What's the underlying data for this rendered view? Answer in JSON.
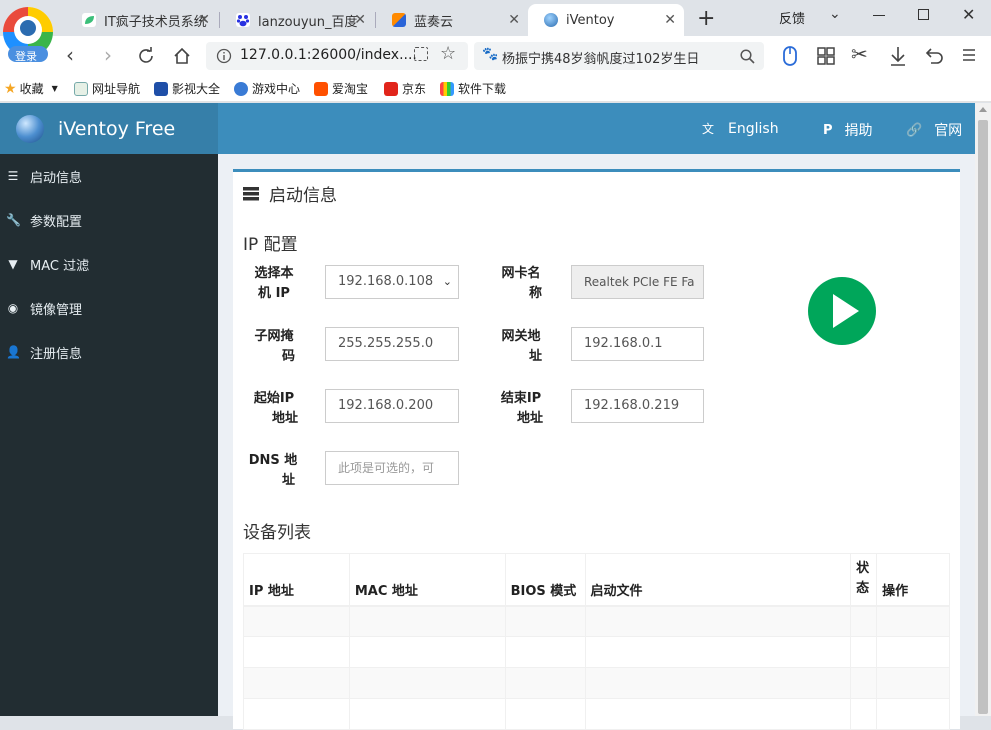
{
  "browser": {
    "login_label": "登录",
    "tabs": [
      {
        "label": "IT疯子技术员系统"
      },
      {
        "label": "lanzouyun_百度"
      },
      {
        "label": "蓝奏云"
      },
      {
        "label": "iVentoy"
      }
    ],
    "new_tab": "+",
    "feedback": "反馈",
    "url": "127.0.0.1:26000/index....",
    "search_text": "杨振宁携48岁翁帆度过102岁生日",
    "bookmarks": [
      "收藏",
      "网址导航",
      "影视大全",
      "游戏中心",
      "爱淘宝",
      "京东",
      "软件下载"
    ]
  },
  "app": {
    "brand": "iVentoy Free",
    "top_links": {
      "english": "English",
      "donate": "捐助",
      "website": "官网"
    },
    "sidebar": [
      {
        "label": "启动信息",
        "icon": "server-icon"
      },
      {
        "label": "参数配置",
        "icon": "wrench-icon"
      },
      {
        "label": "MAC 过滤",
        "icon": "filter-icon"
      },
      {
        "label": "镜像管理",
        "icon": "disc-icon"
      },
      {
        "label": "注册信息",
        "icon": "user-icon"
      }
    ],
    "box_title": "启动信息",
    "ip_section": "IP 配置",
    "fields": {
      "local_ip_label_1": "选择本",
      "local_ip_label_2": "机 IP",
      "local_ip_value": "192.168.0.108",
      "nic_label_1": "网卡名",
      "nic_label_2": "称",
      "nic_value": "Realtek PCIe FE Fa",
      "mask_label_1": "子网掩",
      "mask_label_2": "码",
      "mask_value": "255.255.255.0",
      "gateway_label_1": "网关地",
      "gateway_label_2": "址",
      "gateway_value": "192.168.0.1",
      "start_label_1": "起始IP",
      "start_label_2": "地址",
      "start_value": "192.168.0.200",
      "end_label_1": "结束IP",
      "end_label_2": "地址",
      "end_value": "192.168.0.219",
      "dns_label_1": "DNS 地",
      "dns_label_2": "址",
      "dns_placeholder": "此项是可选的，可"
    },
    "device_section": "设备列表",
    "table_headers": {
      "ip": "IP 地址",
      "mac": "MAC 地址",
      "bios": "BIOS 模式",
      "boot_file": "启动文件",
      "status_1": "状",
      "status_2": "态",
      "action": "操作"
    },
    "colors": {
      "header": "#3c8dbc",
      "logo_bg": "#367fa9",
      "sidebar": "#222d32",
      "play": "#00a65a"
    }
  }
}
